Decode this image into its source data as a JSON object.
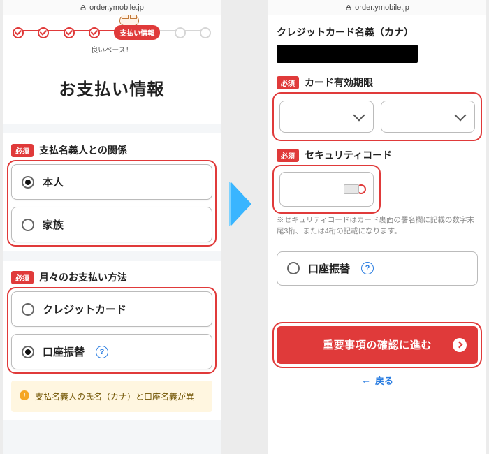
{
  "url": "order.ymobile.jp",
  "left": {
    "step_pill": "支払い情報",
    "pace": "良いペース！",
    "title": "お支払い情報",
    "req": "必須",
    "relation_title": "支払名義人との関係",
    "relation_opts": [
      "本人",
      "家族"
    ],
    "method_title": "月々のお支払い方法",
    "method_opts": [
      "クレジットカード",
      "口座振替"
    ],
    "hint": "支払名義人の氏名（カナ）と口座名義が異"
  },
  "right": {
    "name_label": "クレジットカード名義（カナ）",
    "req": "必須",
    "exp_label": "カード有効期限",
    "sec_label": "セキュリティコード",
    "sec_note": "※セキュリティコードはカード裏面の署名欄に記載の数字末尾3桁、または4桁の記載になります。",
    "bank_opt": "口座振替",
    "cta": "重要事項の確認に進む",
    "back": "戻る"
  }
}
